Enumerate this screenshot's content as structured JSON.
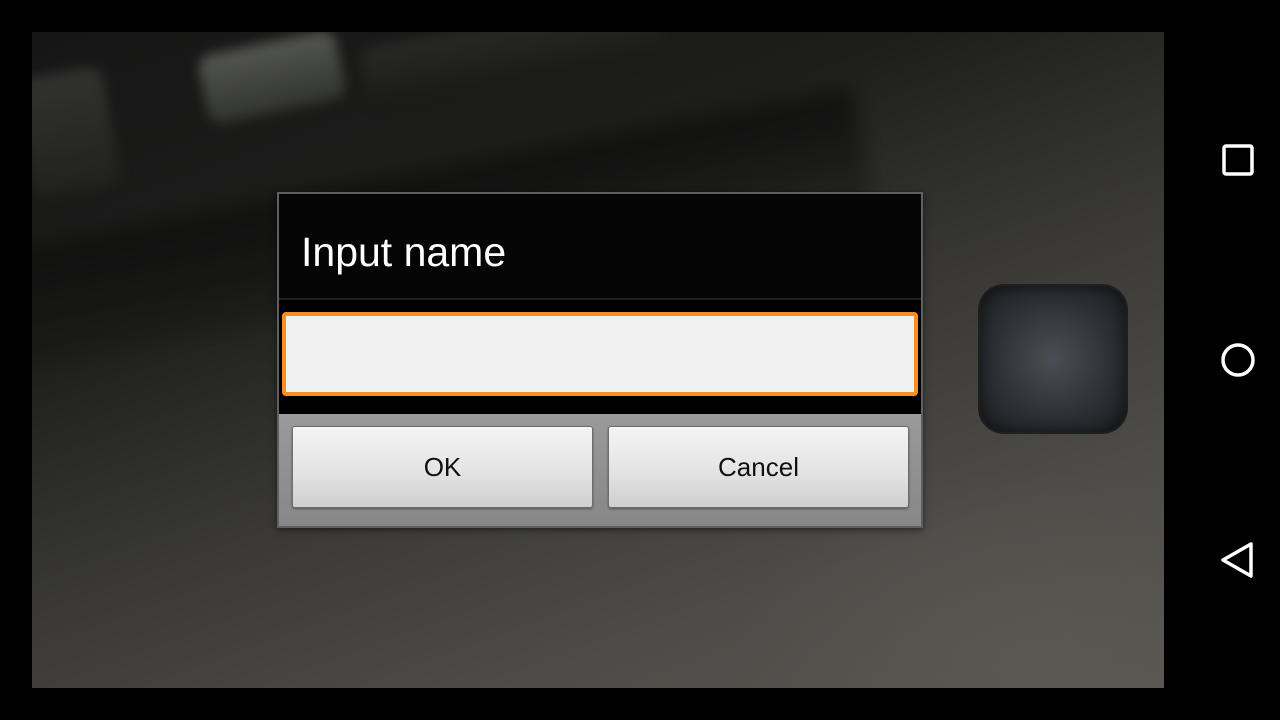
{
  "dialog": {
    "title": "Input name",
    "input_value": "",
    "input_placeholder": "",
    "ok_label": "OK",
    "cancel_label": "Cancel"
  },
  "colors": {
    "input_focus_border": "#f7901e",
    "dialog_title_bg": "#050505",
    "dialog_button_area_bg": "#8b8b8b"
  },
  "icons": {
    "recent_apps": "square-icon",
    "home": "circle-icon",
    "back": "triangle-back-icon",
    "shutter": "shutter-button"
  }
}
